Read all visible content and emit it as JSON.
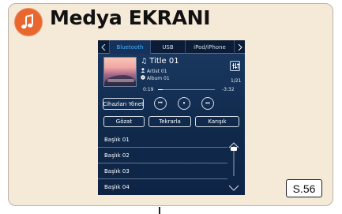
{
  "page": {
    "title": "Medya EKRANI",
    "page_ref": "S.56",
    "icon": "music-note-icon"
  },
  "screen": {
    "tabs": [
      "Bluetooth",
      "USB",
      "iPod/iPhone"
    ],
    "active_tab": "Bluetooth",
    "now_playing": {
      "title": "Title 01",
      "artist": "Artist 01",
      "album": "Album 01",
      "track_count": "1/21",
      "elapsed": "0:19",
      "remaining": "-3:32",
      "progress": 0.09
    },
    "controls": {
      "manage_devices": "Cihazları Yönet",
      "browse": "Gözat",
      "repeat": "Tekrarla",
      "shuffle": "Karışık"
    },
    "list": [
      "Başlık 01",
      "Başlık 02",
      "Başlık 03",
      "Başlık 04"
    ]
  },
  "colors": {
    "card_bg": "#f5e9d7",
    "icon_bg": "#e8672f",
    "screen_bg": "#14305a",
    "active_tab_text": "#46b3ff"
  }
}
